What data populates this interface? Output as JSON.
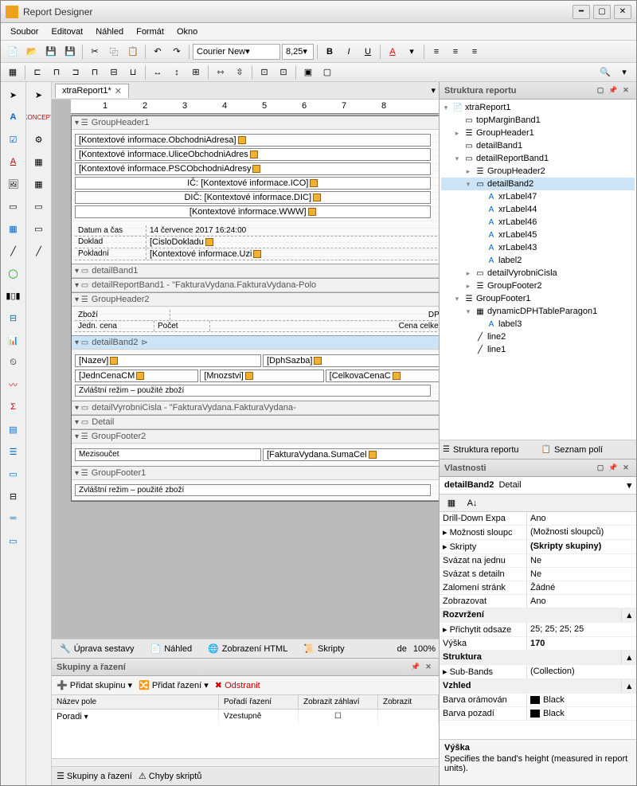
{
  "title": "Report Designer",
  "menu": [
    "Soubor",
    "Editovat",
    "Náhled",
    "Formát",
    "Okno"
  ],
  "font": {
    "name": "Courier New",
    "size": "8,25"
  },
  "tab": {
    "label": "xtraReport1*"
  },
  "bands": {
    "groupHeader1": "GroupHeader1",
    "gh1_fields": [
      "[Kontextové informace.ObchodniAdresa]",
      "[Kontextové informace.UliceObchodniAdres",
      "[Kontextové informace.PSCObchodniAdresy",
      "IČ: [Kontextové informace.ICO]",
      "DIČ: [Kontextové informace.DIC]",
      "[Kontextové informace.WWW]"
    ],
    "gh1_table": {
      "r1c1": "Datum a čas",
      "r1c2": "14 července 2017 16:24:00",
      "r2c1": "Doklad",
      "r2c2": "[CisloDokladu",
      "r3c1": "Pokladní",
      "r3c2": "[Kontextové informace.Uzi"
    },
    "detailBand1": "detailBand1",
    "detailReportBand1": "detailReportBand1 - \"FakturaVydana.FakturaVydana-Polo",
    "groupHeader2": "GroupHeader2",
    "gh2_hdr": {
      "c1": "Zboží",
      "c2": "DPH",
      "c3": "Jedn. cena",
      "c4": "Počet",
      "c5": "Cena celkem"
    },
    "detailBand2": "detailBand2",
    "db2_fields": {
      "nazev": "[Nazev]",
      "dph": "[DphSazba]",
      "jedn": "[JednCenaCM",
      "mnoz": "[Mnozstvi]",
      "celk": "[CelkovaCenaC"
    },
    "db2_text": "Zvláštní režim – použité zboží",
    "detailVyrobniCisla": "detailVyrobniCisla - \"FakturaVydana.FakturaVydana-",
    "detail": "Detail",
    "groupFooter2": "GroupFooter2",
    "gf2": {
      "c1": "Mezisoučet",
      "c2": "[FakturaVydana.SumaCel"
    },
    "groupFooter1": "GroupFooter1",
    "gf1_text": "Zvláštní režim – použité zboží"
  },
  "viewTabs": {
    "design": "Úprava sestavy",
    "preview": "Náhled",
    "html": "Zobrazení HTML",
    "scripts": "Skripty",
    "de": "de",
    "zoom": "100%"
  },
  "groupsPanel": {
    "title": "Skupiny a řazení",
    "addGroup": "Přidat skupinu",
    "addSort": "Přidat řazení",
    "delete": "Odstranit",
    "cols": {
      "name": "Název pole",
      "order": "Pořadí řazení",
      "header": "Zobrazit záhlaví",
      "show": "Zobrazit"
    },
    "row": {
      "name": "Poradi",
      "order": "Vzestupně"
    },
    "tabs": {
      "groups": "Skupiny a řazení",
      "errors": "Chyby skriptů"
    }
  },
  "structure": {
    "title": "Struktura reportu",
    "nodes": {
      "root": "xtraReport1",
      "tmb": "topMarginBand1",
      "gh1": "GroupHeader1",
      "db1": "detailBand1",
      "drb1": "detailReportBand1",
      "gh2": "GroupHeader2",
      "db2": "detailBand2",
      "l47": "xrLabel47",
      "l44": "xrLabel44",
      "l46": "xrLabel46",
      "l45": "xrLabel45",
      "l43": "xrLabel43",
      "lbl2": "label2",
      "dvc": "detailVyrobniCisla",
      "gf2": "GroupFooter2",
      "gf1": "GroupFooter1",
      "dyn": "dynamicDPHTableParagon1",
      "lbl3": "label3",
      "line2": "line2",
      "line1": "line1"
    },
    "tabs": {
      "struct": "Struktura reportu",
      "fields": "Seznam polí"
    }
  },
  "props": {
    "title": "Vlastnosti",
    "obj": "detailBand2",
    "type": "Detail",
    "rows": [
      {
        "n": "Drill-Down Expa",
        "v": "Ano"
      },
      {
        "n": "Možnosti sloupc",
        "v": "(Možnosti sloupců)",
        "exp": true
      },
      {
        "n": "Skripty",
        "v": "(Skripty skupiny)",
        "bold": true,
        "exp": true
      },
      {
        "n": "Svázat na jednu",
        "v": "Ne"
      },
      {
        "n": "Svázat s detailn",
        "v": "Ne"
      },
      {
        "n": "Zalomení stránk",
        "v": "Žádné"
      },
      {
        "n": "Zobrazovat",
        "v": "Ano"
      }
    ],
    "layout": "Rozvržení",
    "layoutRows": [
      {
        "n": "Přichytit odsaze",
        "v": "25; 25; 25; 25",
        "exp": true
      },
      {
        "n": "Výška",
        "v": "170",
        "bold": true
      }
    ],
    "structure": "Struktura",
    "structRows": [
      {
        "n": "Sub-Bands",
        "v": "(Collection)",
        "exp": true
      }
    ],
    "appearance": "Vzhled",
    "appRows": [
      {
        "n": "Barva orámován",
        "v": "Black",
        "swatch": "#000"
      },
      {
        "n": "Barva pozadí",
        "v": "Black",
        "swatch": "#000"
      }
    ],
    "desc": {
      "title": "Výška",
      "text": "Specifies the band's height (measured in report units)."
    }
  }
}
